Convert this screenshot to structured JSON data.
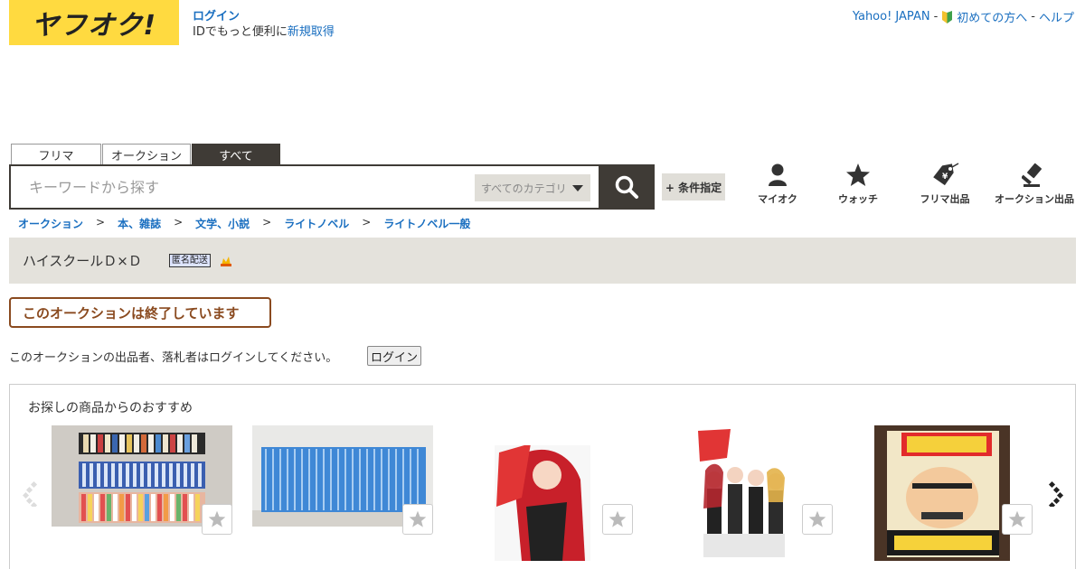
{
  "header": {
    "logo_text": "ヤフオク!",
    "login_link": "ログイン",
    "login_message_prefix": "IDでもっと便利に",
    "signup_link": "新規取得",
    "top_links": {
      "yahoo_japan": "Yahoo! JAPAN",
      "separator": "-",
      "beginner": "初めての方へ",
      "help": "ヘルプ"
    }
  },
  "search": {
    "tabs": [
      "フリマ",
      "オークション",
      "すべて"
    ],
    "active_tab": "すべて",
    "placeholder": "キーワードから探す",
    "category_value": "すべてのカテゴリ",
    "condition_button": "+ 条件指定",
    "nav_items": [
      {
        "label": "マイオク",
        "icon": "person-icon"
      },
      {
        "label": "ウォッチ",
        "icon": "star-icon"
      },
      {
        "label": "フリマ出品",
        "icon": "yen-tag-icon"
      },
      {
        "label": "オークション出品",
        "icon": "gavel-icon"
      }
    ]
  },
  "breadcrumb": {
    "items": [
      "オークション",
      "本、雑誌",
      "文学、小説",
      "ライトノベル",
      "ライトノベル一般"
    ],
    "separator": ">"
  },
  "item": {
    "title": "ハイスクールＤ×Ｄ",
    "badge": "匿名配送"
  },
  "auction": {
    "ended_notice": "このオークションは終了しています",
    "login_message": "このオークションの出品者、落札者はログインしてください。",
    "login_button": "ログイン"
  },
  "recommend": {
    "title": "お探しの商品からのおすすめ",
    "items": [
      {
        "alt": "light-novel-bulk-set-photo"
      },
      {
        "alt": "blue-spine-book-set-photo"
      },
      {
        "alt": "highschool-dxd-manga-cover"
      },
      {
        "alt": "highschool-dxd-vol11-cover"
      },
      {
        "alt": "comic-magazine-cover"
      }
    ]
  },
  "colors": {
    "logo_bg": "#ffda40",
    "dark": "#3f3b36",
    "link": "#1a6fc0",
    "ended": "#8a4a1f",
    "title_bar": "#e4e2dc"
  }
}
